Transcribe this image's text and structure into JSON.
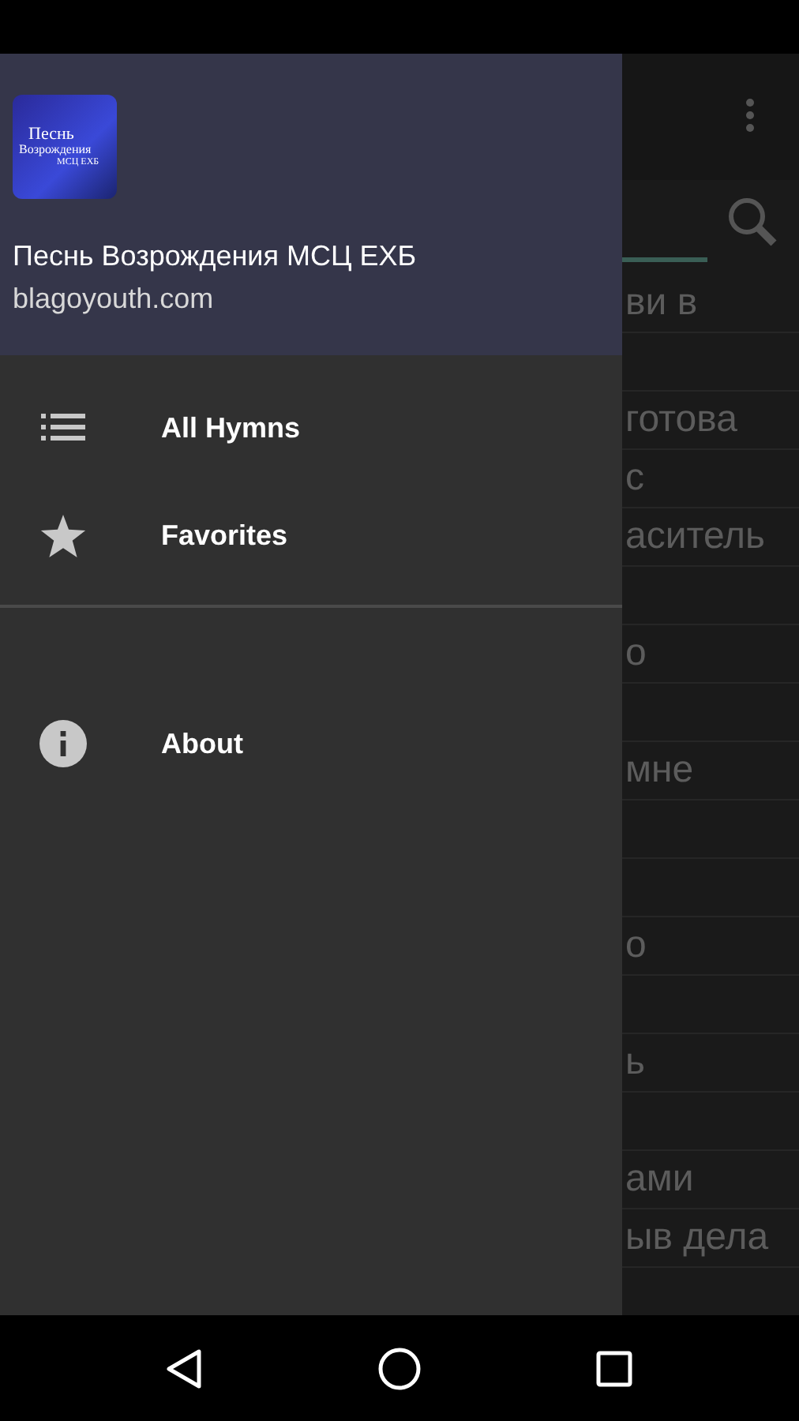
{
  "drawer": {
    "app_title": "Песнь Возрождения МСЦ ЕХБ",
    "subtitle": "blagoyouth.com",
    "logo_lines": [
      "Песнь",
      "Возрождения",
      "МСЦ ЕХБ"
    ],
    "sections": [
      [
        {
          "kind": "list",
          "label": "All Hymns"
        },
        {
          "kind": "star",
          "label": "Favorites"
        }
      ],
      [
        {
          "kind": "info",
          "label": "About"
        }
      ]
    ]
  },
  "background_list": [
    {
      "kind": "text",
      "text": "ви в"
    },
    {
      "kind": "blank"
    },
    {
      "kind": "text",
      "text": "готова"
    },
    {
      "kind": "text",
      "text": "с"
    },
    {
      "kind": "text",
      "text": "аситель"
    },
    {
      "kind": "blank"
    },
    {
      "kind": "text",
      "text": "о"
    },
    {
      "kind": "blank"
    },
    {
      "kind": "text",
      "text": "мне"
    },
    {
      "kind": "blank"
    },
    {
      "kind": "blank"
    },
    {
      "kind": "text",
      "text": "о"
    },
    {
      "kind": "blank"
    },
    {
      "kind": "text",
      "text": "ь"
    },
    {
      "kind": "blank"
    },
    {
      "kind": "text",
      "text": "ами"
    },
    {
      "kind": "text",
      "text": "ыв дела"
    }
  ]
}
